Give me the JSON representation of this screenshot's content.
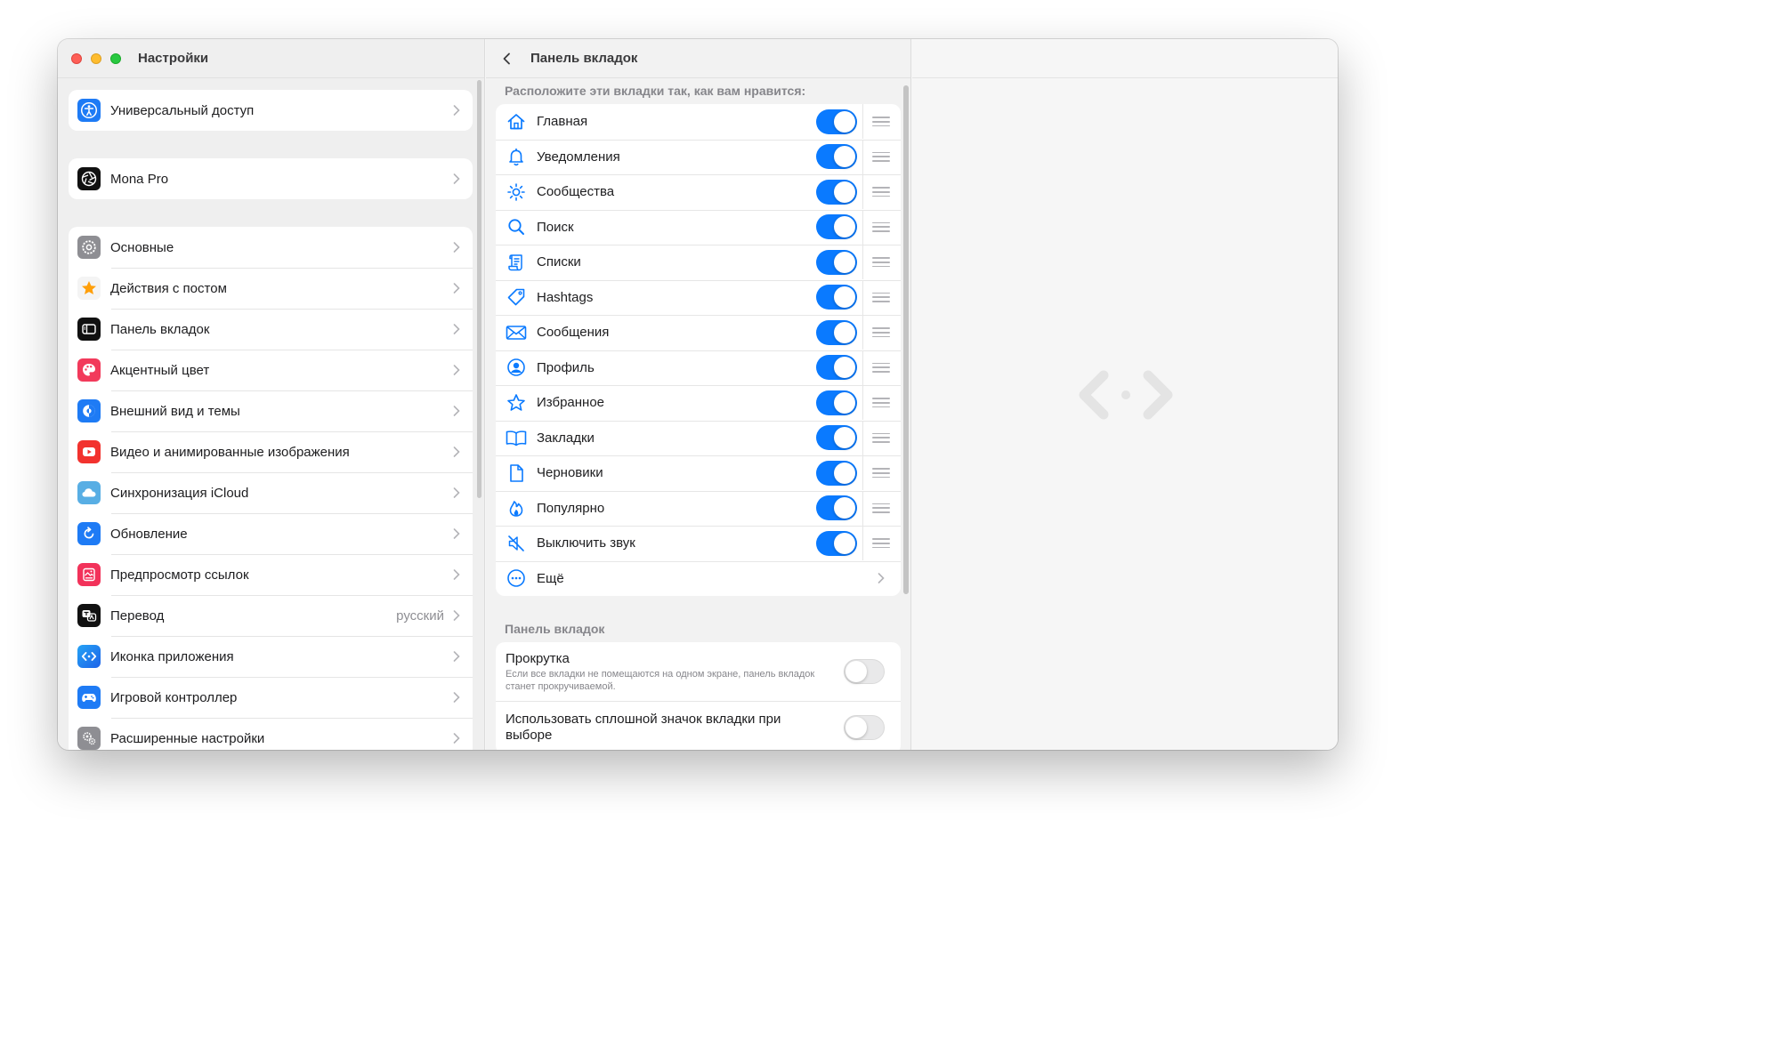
{
  "window": {
    "title": "Настройки"
  },
  "sidebar": {
    "groups": [
      {
        "items": [
          {
            "label": "Универсальный доступ",
            "icon": "accessibility-icon",
            "color": "#1e7bf5"
          }
        ]
      },
      {
        "items": [
          {
            "label": "Mona Pro",
            "icon": "aperture-icon",
            "color": "#111111"
          }
        ]
      },
      {
        "items": [
          {
            "label": "Основные",
            "icon": "gear-icon",
            "color": "#8e8e93"
          },
          {
            "label": "Действия с постом",
            "icon": "star-icon",
            "color": "#f4f4f4"
          },
          {
            "label": "Панель вкладок",
            "icon": "sidebar-layout-icon",
            "color": "#111111"
          },
          {
            "label": "Акцентный цвет",
            "icon": "palette-icon",
            "color": "#f23a5b"
          },
          {
            "label": "Внешний вид и темы",
            "icon": "appearance-icon",
            "color": "#1e7bf5"
          },
          {
            "label": "Видео и анимированные изображения",
            "icon": "play-icon",
            "color": "#f2322e"
          },
          {
            "label": "Синхронизация iCloud",
            "icon": "cloud-icon",
            "color": "#58aee4"
          },
          {
            "label": "Обновление",
            "icon": "refresh-icon",
            "color": "#1e7bf5"
          },
          {
            "label": "Предпросмотр ссылок",
            "icon": "link-preview-icon",
            "color": "#f2325a"
          },
          {
            "label": "Перевод",
            "icon": "translate-icon",
            "color": "#111111",
            "value": "русский"
          },
          {
            "label": "Иконка приложения",
            "icon": "app-icon-icon",
            "color": "#1e7bf5"
          },
          {
            "label": "Игровой контроллер",
            "icon": "gamecontroller-icon",
            "color": "#1e7bf5"
          },
          {
            "label": "Расширенные настройки",
            "icon": "gears-icon",
            "color": "#8e8e93"
          }
        ]
      }
    ]
  },
  "detail": {
    "title": "Панель вкладок",
    "arrange_label": "Расположите эти вкладки так, как вам нравится:",
    "tabs": [
      {
        "label": "Главная",
        "icon": "house-icon",
        "enabled": true
      },
      {
        "label": "Уведомления",
        "icon": "bell-icon",
        "enabled": true
      },
      {
        "label": "Сообщества",
        "icon": "sun-icon",
        "enabled": true
      },
      {
        "label": "Поиск",
        "icon": "magnifier-icon",
        "enabled": true
      },
      {
        "label": "Списки",
        "icon": "scroll-list-icon",
        "enabled": true
      },
      {
        "label": "Hashtags",
        "icon": "tag-icon",
        "enabled": true
      },
      {
        "label": "Сообщения",
        "icon": "envelope-icon",
        "enabled": true
      },
      {
        "label": "Профиль",
        "icon": "person-circle-icon",
        "enabled": true
      },
      {
        "label": "Избранное",
        "icon": "star-outline-icon",
        "enabled": true
      },
      {
        "label": "Закладки",
        "icon": "book-icon",
        "enabled": true
      },
      {
        "label": "Черновики",
        "icon": "document-icon",
        "enabled": true
      },
      {
        "label": "Популярно",
        "icon": "flame-icon",
        "enabled": true
      },
      {
        "label": "Выключить звук",
        "icon": "speaker-muted-icon",
        "enabled": true
      }
    ],
    "more_label": "Ещё",
    "section_label": "Панель вкладок",
    "options": [
      {
        "title": "Прокрутка",
        "description": "Если все вкладки не помещаются на одном экране, панель вкладок станет прокручиваемой.",
        "enabled": false
      },
      {
        "title": "Использовать сплошной значок вкладки при выборе",
        "enabled": false
      }
    ]
  },
  "colors": {
    "accent": "#0a7aff",
    "toggle_off": "#e9e9ea"
  }
}
